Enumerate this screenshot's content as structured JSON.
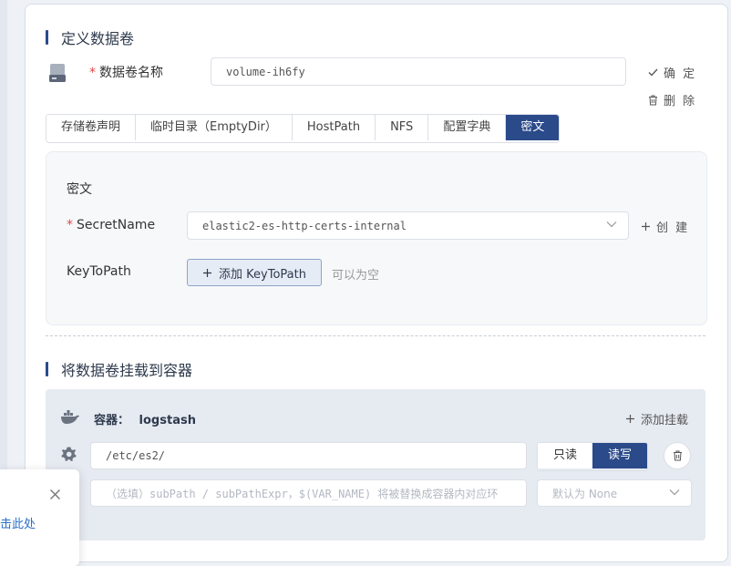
{
  "define_section": {
    "title": "定义数据卷"
  },
  "volume_name": {
    "label": "数据卷名称",
    "required_mark": "*",
    "value": "volume-ih6fy"
  },
  "actions": {
    "confirm": "确 定",
    "delete": "删 除"
  },
  "tabs": [
    {
      "label": "存储卷声明",
      "active": false
    },
    {
      "label": "临时目录（EmptyDir）",
      "active": false
    },
    {
      "label": "HostPath",
      "active": false
    },
    {
      "label": "NFS",
      "active": false
    },
    {
      "label": "配置字典",
      "active": false
    },
    {
      "label": "密文",
      "active": true
    }
  ],
  "secret_panel": {
    "heading": "密文",
    "secret_name_label": "SecretName",
    "secret_name_value": "elastic2-es-http-certs-internal",
    "create_label": "创 建",
    "key_to_path_label": "KeyToPath",
    "add_key_to_path_button": "添加 KeyToPath",
    "optional_hint": "可以为空"
  },
  "mount_section": {
    "title": "将数据卷挂载到容器"
  },
  "container": {
    "label": "容器：",
    "name": "logstash",
    "add_mount": "添加挂载",
    "mount_path": "/etc/es2/",
    "readonly_label": "只读",
    "readwrite_label": "读写",
    "subpath_placeholder": "（选填）subPath / subPathExpr，$(VAR_NAME) 将被替换成容器内对应环",
    "propagation_placeholder": "默认为 None"
  },
  "toast": {
    "link_text": "击此处"
  },
  "colors": {
    "accent": "#2a4a8a",
    "required": "#e0474a",
    "link": "#2a6fc9"
  }
}
